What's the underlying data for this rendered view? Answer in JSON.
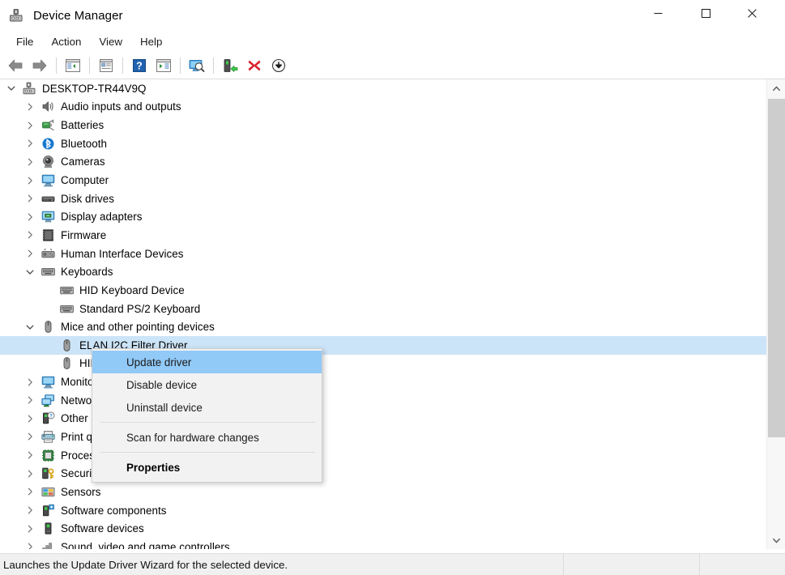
{
  "window": {
    "title": "Device Manager",
    "icon": "device-manager-icon",
    "controls": {
      "minimize": "—",
      "maximize": "□",
      "close": "✕"
    }
  },
  "menubar": {
    "items": [
      {
        "label": "File",
        "name": "menu-file"
      },
      {
        "label": "Action",
        "name": "menu-action"
      },
      {
        "label": "View",
        "name": "menu-view"
      },
      {
        "label": "Help",
        "name": "menu-help"
      }
    ]
  },
  "toolbar": {
    "buttons": [
      {
        "name": "back-button",
        "icon": "back-arrow-icon"
      },
      {
        "name": "forward-button",
        "icon": "forward-arrow-icon"
      },
      {
        "sep": true
      },
      {
        "name": "show-hide-console-tree-button",
        "icon": "console-tree-icon"
      },
      {
        "sep": true
      },
      {
        "name": "properties-button",
        "icon": "properties-window-icon"
      },
      {
        "sep": true
      },
      {
        "name": "help-button",
        "icon": "question-mark-icon"
      },
      {
        "name": "show-hide-action-pane-button",
        "icon": "action-pane-icon"
      },
      {
        "sep": true
      },
      {
        "name": "scan-hardware-changes-button",
        "icon": "scan-monitor-icon"
      },
      {
        "sep": true
      },
      {
        "name": "update-driver-button",
        "icon": "update-driver-icon"
      },
      {
        "name": "uninstall-device-button",
        "icon": "red-x-icon"
      },
      {
        "name": "disable-device-button",
        "icon": "disable-down-arrow-icon"
      }
    ]
  },
  "tree": {
    "rows": [
      {
        "label": "DESKTOP-TR44V9Q",
        "depth": 0,
        "twisty": "down",
        "icon": "computer-root-icon",
        "selected": false
      },
      {
        "label": "Audio inputs and outputs",
        "depth": 1,
        "twisty": "right",
        "icon": "speaker-icon",
        "selected": false
      },
      {
        "label": "Batteries",
        "depth": 1,
        "twisty": "right",
        "icon": "battery-icon",
        "selected": false
      },
      {
        "label": "Bluetooth",
        "depth": 1,
        "twisty": "right",
        "icon": "bluetooth-icon",
        "selected": false
      },
      {
        "label": "Cameras",
        "depth": 1,
        "twisty": "right",
        "icon": "camera-icon",
        "selected": false
      },
      {
        "label": "Computer",
        "depth": 1,
        "twisty": "right",
        "icon": "monitor-icon",
        "selected": false
      },
      {
        "label": "Disk drives",
        "depth": 1,
        "twisty": "right",
        "icon": "disk-drive-icon",
        "selected": false
      },
      {
        "label": "Display adapters",
        "depth": 1,
        "twisty": "right",
        "icon": "display-adapter-icon",
        "selected": false
      },
      {
        "label": "Firmware",
        "depth": 1,
        "twisty": "right",
        "icon": "firmware-chip-icon",
        "selected": false
      },
      {
        "label": "Human Interface Devices",
        "depth": 1,
        "twisty": "right",
        "icon": "hid-icon",
        "selected": false
      },
      {
        "label": "Keyboards",
        "depth": 1,
        "twisty": "down",
        "icon": "keyboard-icon",
        "selected": false
      },
      {
        "label": "HID Keyboard Device",
        "depth": 2,
        "twisty": "none",
        "icon": "keyboard-icon",
        "selected": false
      },
      {
        "label": "Standard PS/2 Keyboard",
        "depth": 2,
        "twisty": "none",
        "icon": "keyboard-icon",
        "selected": false
      },
      {
        "label": "Mice and other pointing devices",
        "depth": 1,
        "twisty": "down",
        "icon": "mouse-icon",
        "selected": false
      },
      {
        "label": "ELAN I2C Filter Driver",
        "depth": 2,
        "twisty": "none",
        "icon": "mouse-icon",
        "selected": true
      },
      {
        "label": "HID-compliant mouse",
        "depth": 2,
        "twisty": "none",
        "icon": "mouse-icon",
        "selected": false
      },
      {
        "label": "Monitors",
        "depth": 1,
        "twisty": "right",
        "icon": "monitor-icon",
        "selected": false
      },
      {
        "label": "Network adapters",
        "depth": 1,
        "twisty": "right",
        "icon": "network-adapter-icon",
        "selected": false
      },
      {
        "label": "Other devices",
        "depth": 1,
        "twisty": "right",
        "icon": "unknown-device-icon",
        "selected": false
      },
      {
        "label": "Print queues",
        "depth": 1,
        "twisty": "right",
        "icon": "printer-icon",
        "selected": false
      },
      {
        "label": "Processors",
        "depth": 1,
        "twisty": "right",
        "icon": "processor-icon",
        "selected": false
      },
      {
        "label": "Security devices",
        "depth": 1,
        "twisty": "right",
        "icon": "security-device-icon",
        "selected": false
      },
      {
        "label": "Sensors",
        "depth": 1,
        "twisty": "right",
        "icon": "sensor-icon",
        "selected": false
      },
      {
        "label": "Software components",
        "depth": 1,
        "twisty": "right",
        "icon": "software-component-icon",
        "selected": false
      },
      {
        "label": "Software devices",
        "depth": 1,
        "twisty": "right",
        "icon": "software-device-icon",
        "selected": false
      },
      {
        "label": "Sound, video and game controllers",
        "depth": 1,
        "twisty": "right",
        "icon": "sound-controller-icon",
        "selected": false
      }
    ]
  },
  "context_menu": {
    "items": [
      {
        "label": "Update driver",
        "name": "ctx-update-driver",
        "highlighted": true,
        "bold": false
      },
      {
        "label": "Disable device",
        "name": "ctx-disable-device",
        "highlighted": false,
        "bold": false
      },
      {
        "label": "Uninstall device",
        "name": "ctx-uninstall-device",
        "highlighted": false,
        "bold": false
      },
      {
        "separator": true
      },
      {
        "label": "Scan for hardware changes",
        "name": "ctx-scan-hardware",
        "highlighted": false,
        "bold": false
      },
      {
        "separator": true
      },
      {
        "label": "Properties",
        "name": "ctx-properties",
        "highlighted": false,
        "bold": true
      }
    ]
  },
  "statusbar": {
    "text": "Launches the Update Driver Wizard for the selected device."
  },
  "colors": {
    "selection_blue": "#cce4f7",
    "menu_highlight_blue": "#91c9f7",
    "menu_background": "#f2f2f2",
    "statusbar_background": "#f0f0f0",
    "scrollbar_thumb": "#cdcdcd"
  }
}
